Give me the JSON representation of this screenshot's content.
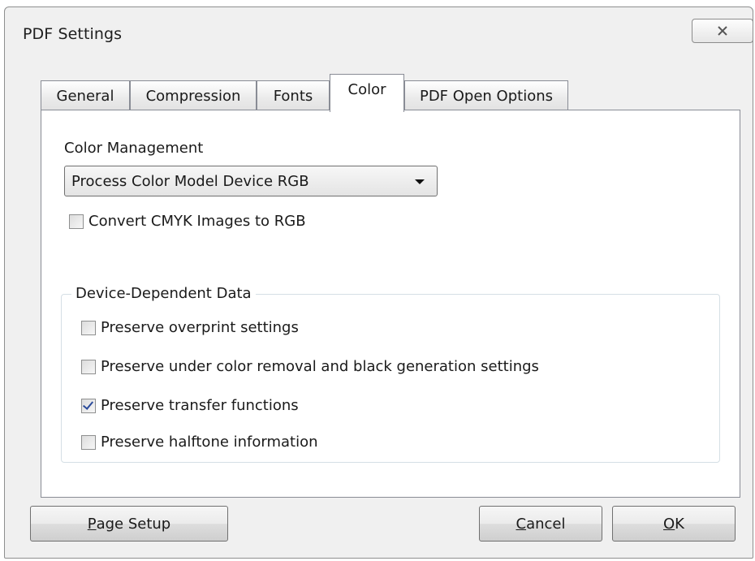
{
  "window": {
    "title": "PDF Settings",
    "close_icon": "close-icon"
  },
  "tabs": [
    {
      "label": "General"
    },
    {
      "label": "Compression"
    },
    {
      "label": "Fonts"
    },
    {
      "label": "Color",
      "active": true
    },
    {
      "label": "PDF Open Options"
    }
  ],
  "color_tab": {
    "management_label": "Color Management",
    "management_value": "Process Color Model Device RGB",
    "convert_cmyk_label": "Convert CMYK Images to RGB",
    "convert_cmyk_checked": false,
    "device_group": {
      "title": "Device-Dependent Data",
      "options": [
        {
          "label": "Preserve overprint settings",
          "checked": false
        },
        {
          "label": "Preserve under color removal and black generation settings",
          "checked": false
        },
        {
          "label": "Preserve transfer functions",
          "checked": true
        },
        {
          "label": "Preserve halftone information",
          "checked": false
        }
      ]
    }
  },
  "buttons": {
    "page_setup": {
      "mnemonic": "P",
      "rest": "age Setup"
    },
    "cancel": {
      "mnemonic": "C",
      "rest": "ancel"
    },
    "ok": {
      "mnemonic": "O",
      "rest": "K"
    }
  },
  "colors": {
    "check_mark": "#2b4b9b",
    "window_bg": "#f0f0f0"
  }
}
